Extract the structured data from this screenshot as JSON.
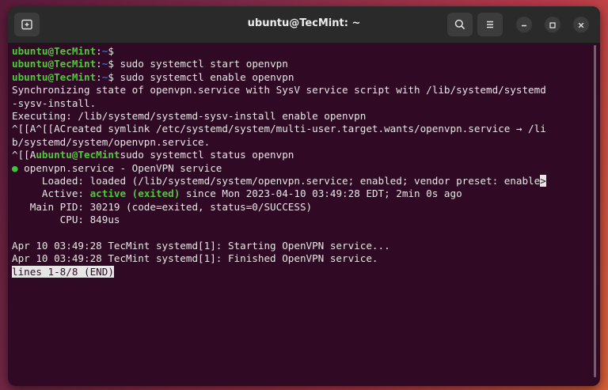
{
  "window": {
    "title": "ubuntu@TecMint: ~"
  },
  "icons": {
    "new_tab": "new-tab-icon",
    "search": "search-icon",
    "menu": "hamburger-menu-icon",
    "minimize": "minimize-icon",
    "maximize": "maximize-icon",
    "close": "close-icon"
  },
  "colors": {
    "terminal_bg": "#300a24",
    "prompt_user": "#4ec93a",
    "prompt_path": "#2f6cd6",
    "status_active": "#4ec93a"
  },
  "terminal": {
    "prompt_user": "ubuntu@TecMint",
    "prompt_colon": ":",
    "prompt_path": "~",
    "prompt_dollar": "$",
    "line1_cmd": "",
    "line2_cmd": " sudo systemctl start openvpn",
    "line3_cmd": " sudo systemctl enable openvpn",
    "line4": "Synchronizing state of openvpn.service with SysV service script with /lib/systemd/systemd",
    "line5": "-sysv-install.",
    "line6": "Executing: /lib/systemd/systemd-sysv-install enable openvpn",
    "line7": "^[[A^[[ACreated symlink /etc/systemd/system/multi-user.target.wants/openvpn.service → /li",
    "line8": "b/systemd/system/openvpn.service.",
    "line9_prefix": "^[[A",
    "line9_cmd": "sudo systemctl status openvpn",
    "status_dot": "●",
    "service_line": " openvpn.service - OpenVPN service",
    "loaded_line": "     Loaded: loaded (/lib/systemd/system/openvpn.service; enabled; vendor preset: enable",
    "truncation_marker": ">",
    "active_label": "     Active: ",
    "active_value": "active (exited)",
    "active_rest": " since Mon 2023-04-10 03:49:28 EDT; 2min 0s ago",
    "mainpid_line": "   Main PID: 30219 (code=exited, status=0/SUCCESS)",
    "cpu_line": "        CPU: 849us",
    "log1": "Apr 10 03:49:28 TecMint systemd[1]: Starting OpenVPN service...",
    "log2": "Apr 10 03:49:28 TecMint systemd[1]: Finished OpenVPN service.",
    "pager_status": "lines 1-8/8 (END)"
  }
}
